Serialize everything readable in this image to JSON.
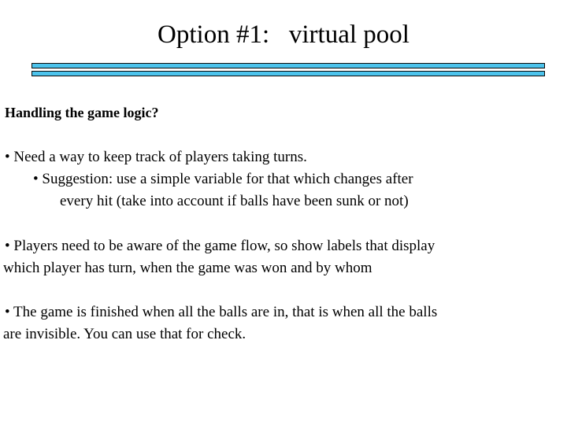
{
  "slide": {
    "title": "Option #1:   virtual pool",
    "background_color": "#ffffff",
    "text_color": "#000000",
    "rule": {
      "fill_color": "#4CC3EC",
      "border_color": "#0a0a0a",
      "bar_count": 2
    },
    "heading": "Handling the game logic?",
    "content": [
      {
        "id": "bullet-group-1",
        "lines": [
          {
            "id": "b1-l1",
            "level": 1,
            "text": "• Need a way to keep track of players taking turns."
          },
          {
            "id": "b1-l2",
            "level": 2,
            "text": "• Suggestion: use a simple variable for that which changes after"
          },
          {
            "id": "b1-l3",
            "level": 3,
            "text": "every hit (take into account if balls have been sunk or not)"
          }
        ]
      },
      {
        "id": "bullet-group-2",
        "lines": [
          {
            "id": "b2-l1",
            "level": 1,
            "text": "• Players need to be aware of the game flow, so show labels that display"
          },
          {
            "id": "b2-l2",
            "level": 4,
            "text": "which player has turn, when the game was won and by whom"
          }
        ]
      },
      {
        "id": "bullet-group-3",
        "lines": [
          {
            "id": "b3-l1",
            "level": 1,
            "text": "• The game is finished when all the balls are in, that is when all the balls"
          },
          {
            "id": "b3-l2",
            "level": 4,
            "text": "are invisible. You can use that for check."
          }
        ]
      }
    ]
  }
}
